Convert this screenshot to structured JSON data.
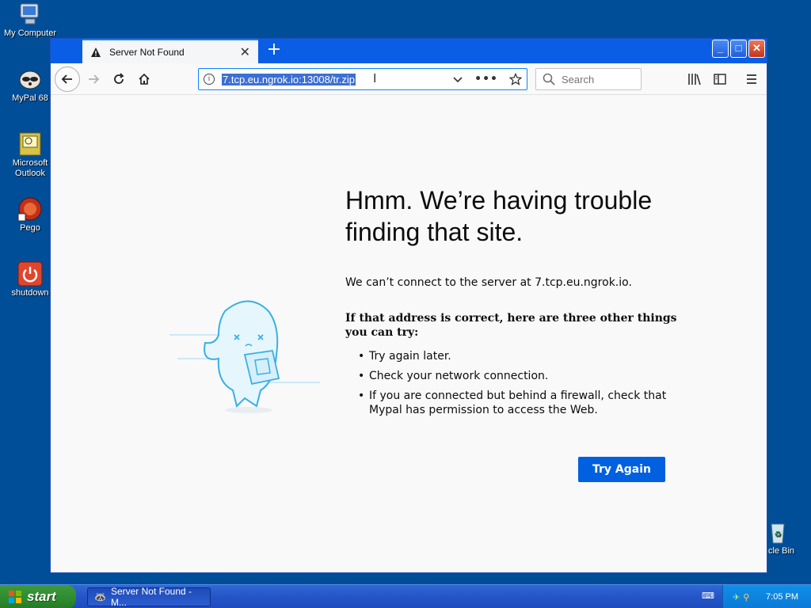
{
  "desktop": {
    "icons": [
      {
        "label": "My Computer",
        "icon": "computer-icon"
      },
      {
        "label": "MyPal 68",
        "icon": "raccoon-browser-icon"
      },
      {
        "label": "Microsoft Outlook",
        "icon": "outlook-icon"
      },
      {
        "label": "Pego",
        "icon": "pego-icon"
      },
      {
        "label": "shutdown",
        "icon": "power-icon"
      },
      {
        "label": "cle Bin",
        "icon": "recycle-bin-icon"
      }
    ]
  },
  "browser": {
    "tab_title": "Server Not Found",
    "new_tab": "+",
    "url": "7.tcp.eu.ngrok.io:13008/tr.zip",
    "search_placeholder": "Search",
    "window_buttons": {
      "minimize": "_",
      "maximize": "□",
      "close": "✕"
    }
  },
  "error_page": {
    "heading": "Hmm. We’re having trouble finding that site.",
    "message": "We can’t connect to the server at 7.tcp.eu.ngrok.io.",
    "suggestions_title": "If that address is correct, here are three other things you can try:",
    "suggestions": [
      "Try again later.",
      "Check your network connection.",
      "If you are connected but behind a firewall, check that Mypal has permission to access the Web."
    ],
    "button_label": "Try Again"
  },
  "taskbar": {
    "start_label": "start",
    "task_item": "Server Not Found - M...",
    "clock": "7:05 PM"
  },
  "colors": {
    "desktop_bg": "#004e98",
    "accent": "#0060df",
    "url_highlight": "#3b6fd4"
  }
}
